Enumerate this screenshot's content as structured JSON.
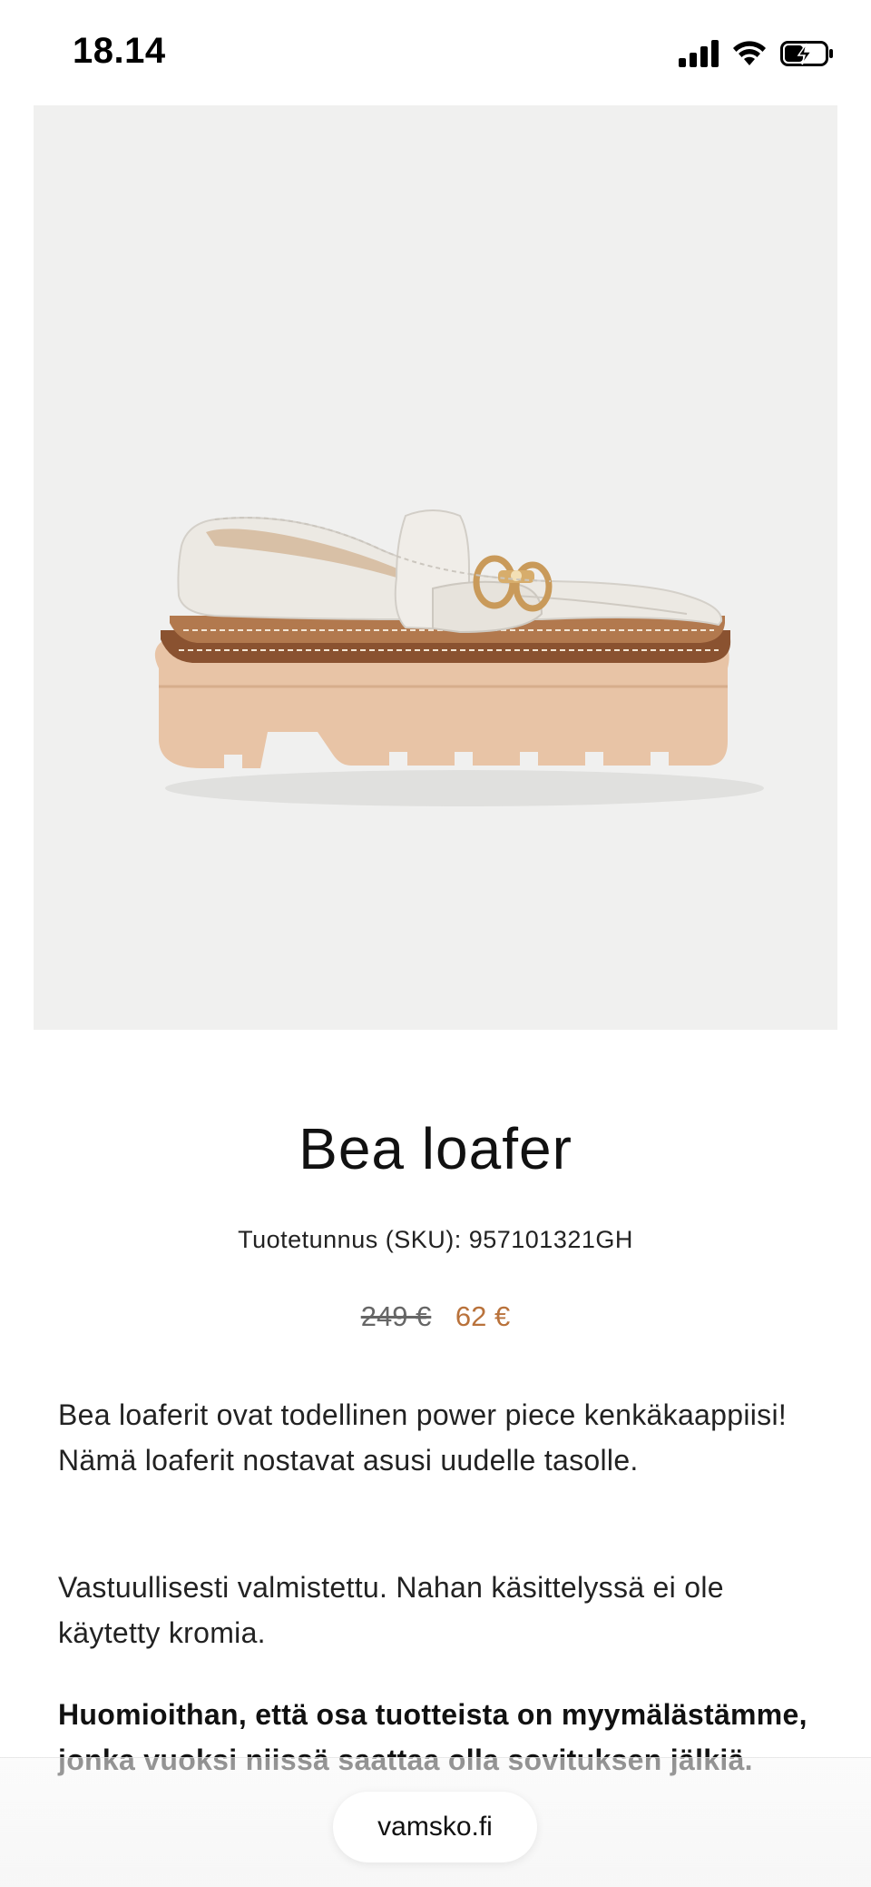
{
  "status_bar": {
    "time": "18.14",
    "icons": [
      "cellular-signal-icon",
      "wifi-icon",
      "battery-charging-icon"
    ]
  },
  "gallery": {
    "image_alt": "Bea loafer product photo",
    "dots": [
      {
        "active": true
      },
      {
        "active": false
      },
      {
        "active": false
      },
      {
        "active": false
      },
      {
        "active": false
      }
    ]
  },
  "product": {
    "title": "Bea loafer",
    "sku": "Tuotetunnus (SKU): 957101321GH",
    "price_old": "249 €",
    "price_new": "62 €",
    "description_1": "Bea loaferit ovat todellinen power piece kenkäkaappiisi! Nämä loaferit nostavat asusi uudelle tasolle.",
    "description_2": "Vastuullisesti valmistettu. Nahan käsittelyssä ei ole käytetty kromia.",
    "notice": "Huomioithan, että osa tuotteista on myymälästämme, jonka vuoksi niissä saattaa olla sovituksen jälkiä."
  },
  "browser": {
    "url": "vamsko.fi"
  },
  "colors": {
    "accent_price": "#b9723b",
    "image_bg": "#f0f0ef",
    "sole": "#e8c4a6",
    "leather": "#ece9e3",
    "welt": "#8a5230",
    "buckle": "#c99a5a"
  }
}
